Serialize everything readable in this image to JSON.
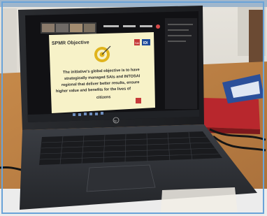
{
  "photo": {
    "subject": "laptop-on-table-showing-video-conference",
    "meeting_toolbar": [
      "",
      "",
      ""
    ],
    "laptop_brand": "hp"
  },
  "slide": {
    "title": "SPMR Objective",
    "logo_left": "SAI",
    "logo_right": "IDI",
    "body_lines": [
      "The initiative's global objective is to have",
      "strategically managed SAIs and INTOSAI",
      "regional that deliver better results, ensure",
      "higher value and benefits for the lives of",
      "citizens"
    ]
  },
  "colors": {
    "accent_frame": "#6aa3d8",
    "slide_bg": "#f7f2c8",
    "laptop_body": "#3a3d42",
    "table": "#c98c4e",
    "red_folder": "#b8272d",
    "blue_booklet": "#2b4f9a"
  }
}
